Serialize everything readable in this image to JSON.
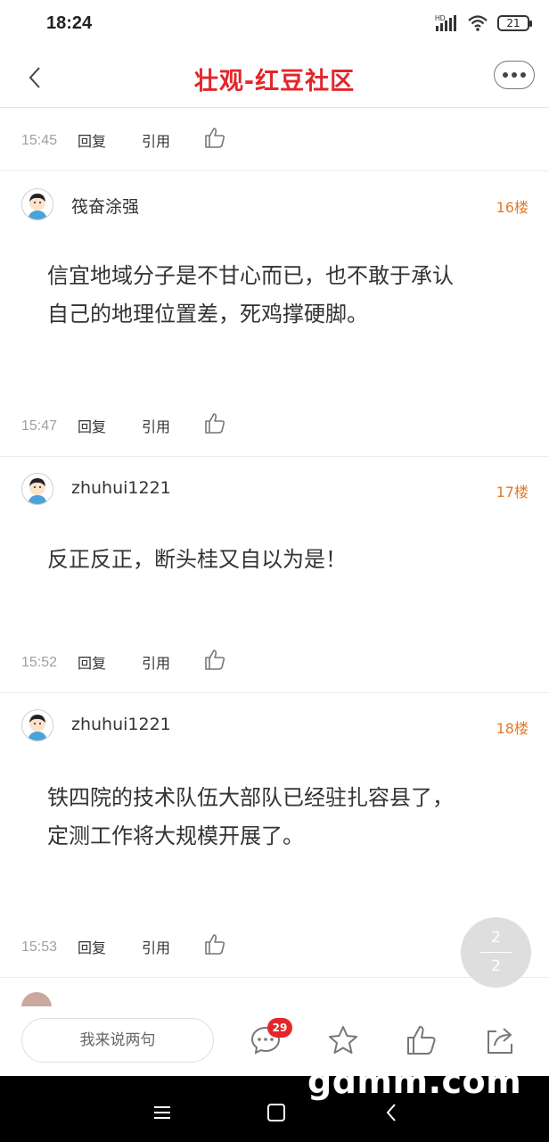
{
  "status_bar": {
    "time": "18:24",
    "network": "HD",
    "battery": "21"
  },
  "nav": {
    "title": "壮观-红豆社区"
  },
  "top_actions": {
    "time": "15:45",
    "reply": "回复",
    "quote": "引用"
  },
  "posts": [
    {
      "username": "筏奋涂强",
      "floor": "16楼",
      "lines": [
        "信宜地域分子是不甘心而已，也不敢于承认",
        "自己的地理位置差，死鸡撑硬脚。"
      ],
      "time": "15:47",
      "reply": "回复",
      "quote": "引用"
    },
    {
      "username": "zhuhui1221",
      "floor": "17楼",
      "lines": [
        "反正反正，断头桂又自以为是！"
      ],
      "time": "15:52",
      "reply": "回复",
      "quote": "引用"
    },
    {
      "username": "zhuhui1221",
      "floor": "18楼",
      "lines": [
        "铁四院的技术队伍大部队已经驻扎容县了，",
        "定测工作将大规模开展了。"
      ],
      "time": "15:53",
      "reply": "回复",
      "quote": "引用"
    }
  ],
  "pager": {
    "current": "2",
    "total": "2"
  },
  "bottom_bar": {
    "comment_placeholder": "我来说两句",
    "comment_count": "29"
  },
  "watermark": "gdmm.com",
  "colors": {
    "brand_red": "#e3262a",
    "floor_orange": "#e27a2c"
  }
}
